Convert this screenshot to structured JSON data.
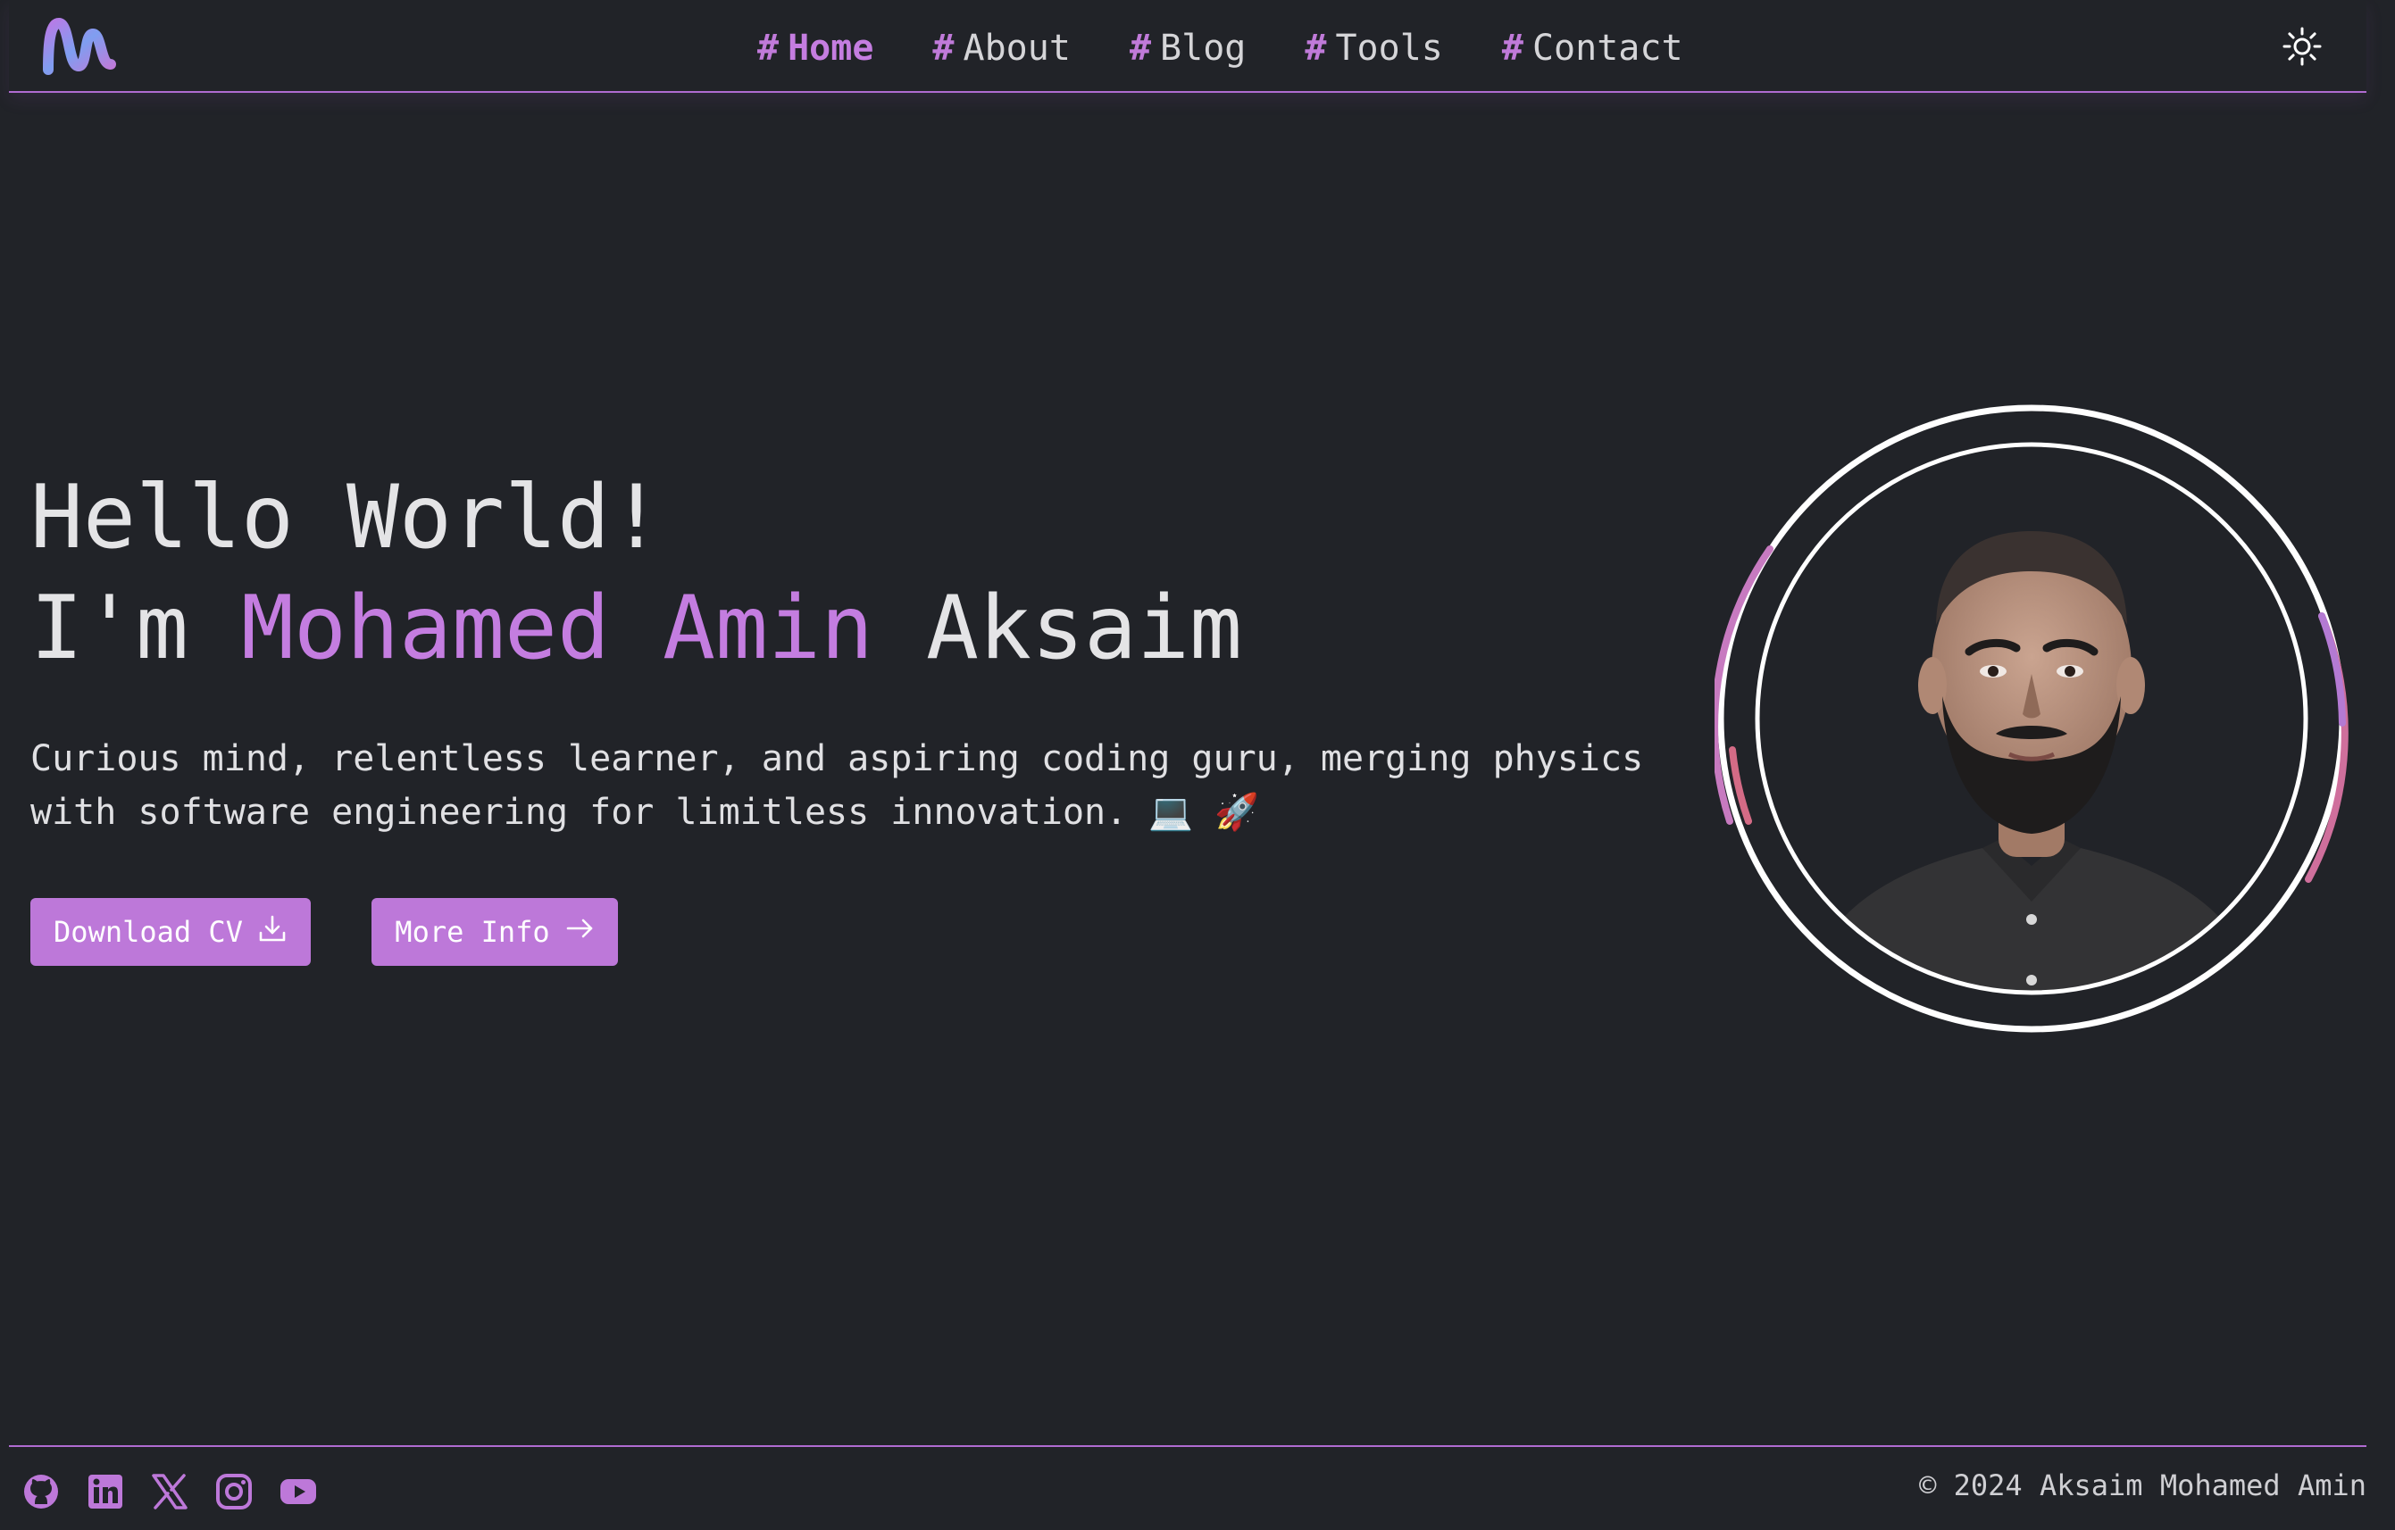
{
  "colors": {
    "background": "#212328",
    "accent": "#c47de0",
    "button": "#bd78d9",
    "text": "#e4e4e6"
  },
  "header": {
    "logo_icon": "brand-m-logo-icon",
    "nav": [
      {
        "hash": "#",
        "label": "Home",
        "active": true
      },
      {
        "hash": "#",
        "label": "About",
        "active": false
      },
      {
        "hash": "#",
        "label": "Blog",
        "active": false
      },
      {
        "hash": "#",
        "label": "Tools",
        "active": false
      },
      {
        "hash": "#",
        "label": "Contact",
        "active": false
      }
    ],
    "theme_toggle_icon": "sun-icon"
  },
  "hero": {
    "greeting": "Hello World!",
    "intro_prefix": "I'm ",
    "name_highlight": "Mohamed Amin",
    "name_rest": " Aksaim",
    "description": "Curious mind, relentless learner, and aspiring coding guru, merging physics with software engineering for limitless innovation. 💻 🚀",
    "buttons": {
      "download_cv": "Download CV",
      "download_icon": "download-icon",
      "more_info": "More Info",
      "more_info_icon": "arrow-right-icon"
    },
    "avatar_alt": "profile-photo"
  },
  "footer": {
    "socials": [
      "github-icon",
      "linkedin-icon",
      "x-icon",
      "instagram-icon",
      "youtube-icon"
    ],
    "copyright": "© 2024 Aksaim Mohamed Amin"
  }
}
